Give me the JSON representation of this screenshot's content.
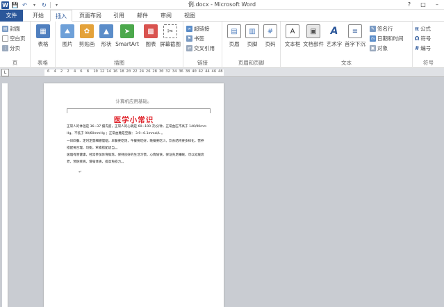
{
  "window": {
    "title": "例.docx - Microsoft Word"
  },
  "tabs": [
    {
      "label": "文件"
    },
    {
      "label": "开始"
    },
    {
      "label": "插入"
    },
    {
      "label": "页面布局"
    },
    {
      "label": "引用"
    },
    {
      "label": "邮件"
    },
    {
      "label": "审阅"
    },
    {
      "label": "视图"
    }
  ],
  "ribbon": {
    "pages": {
      "label": "页",
      "cover": "封面",
      "blank": "空白页",
      "break": "分页"
    },
    "tables": {
      "label": "表格",
      "table": "表格"
    },
    "illustrations": {
      "label": "插图",
      "picture": "图片",
      "clipart": "剪贴画",
      "shapes": "形状",
      "smartart": "SmartArt",
      "chart": "图表",
      "screenshot": "屏幕截图"
    },
    "links": {
      "label": "链接",
      "hyperlink": "超链接",
      "bookmark": "书签",
      "crossref": "交叉引用"
    },
    "header_footer": {
      "label": "页眉和页脚",
      "header": "页眉",
      "footer": "页脚",
      "page_number": "页码"
    },
    "text": {
      "label": "文本",
      "textbox": "文本框",
      "quickparts": "文档部件",
      "wordart": "艺术字",
      "dropcap": "首字下沉",
      "signature": "签名行",
      "datetime": "日期和时间",
      "object": "对象"
    },
    "symbols": {
      "label": "符号",
      "equation": "公式",
      "symbol": "符号",
      "number": "编号"
    }
  },
  "ruler": {
    "numbers": [
      "6",
      "4",
      "2",
      "2",
      "4",
      "6",
      "8",
      "10",
      "12",
      "14",
      "16",
      "18",
      "20",
      "22",
      "24",
      "26",
      "28",
      "30",
      "32",
      "34",
      "36",
      "38",
      "40",
      "42",
      "44",
      "46",
      "48"
    ]
  },
  "document": {
    "header_text": "计算机应用基础。",
    "heading": "医学小常识",
    "paragraphs": [
      "正常人的体温是 36~37 摄氏度，正常人的心跳是 60~100 次/分钟，正常血压不高于 140/90mmHg，不低于 90/60mmHg ；正常血糖是空腹： 3.9~6.1mmol/L 。",
      "一日四餐、定时定量细嚼慢咽，早餐要吃饱，午餐要吃好，晚餐要吃少。饮食结构要多样化，营养搭配要合理、均衡，荤素搭配适当。。",
      "吸烟有害健康，经常参加体育锻炼，保持良好的生活习惯，心情愉快，保证充足睡眠，可以延缓衰老，预防疾病，增强体质，提高免疫力。。"
    ],
    "caret": "↵"
  }
}
